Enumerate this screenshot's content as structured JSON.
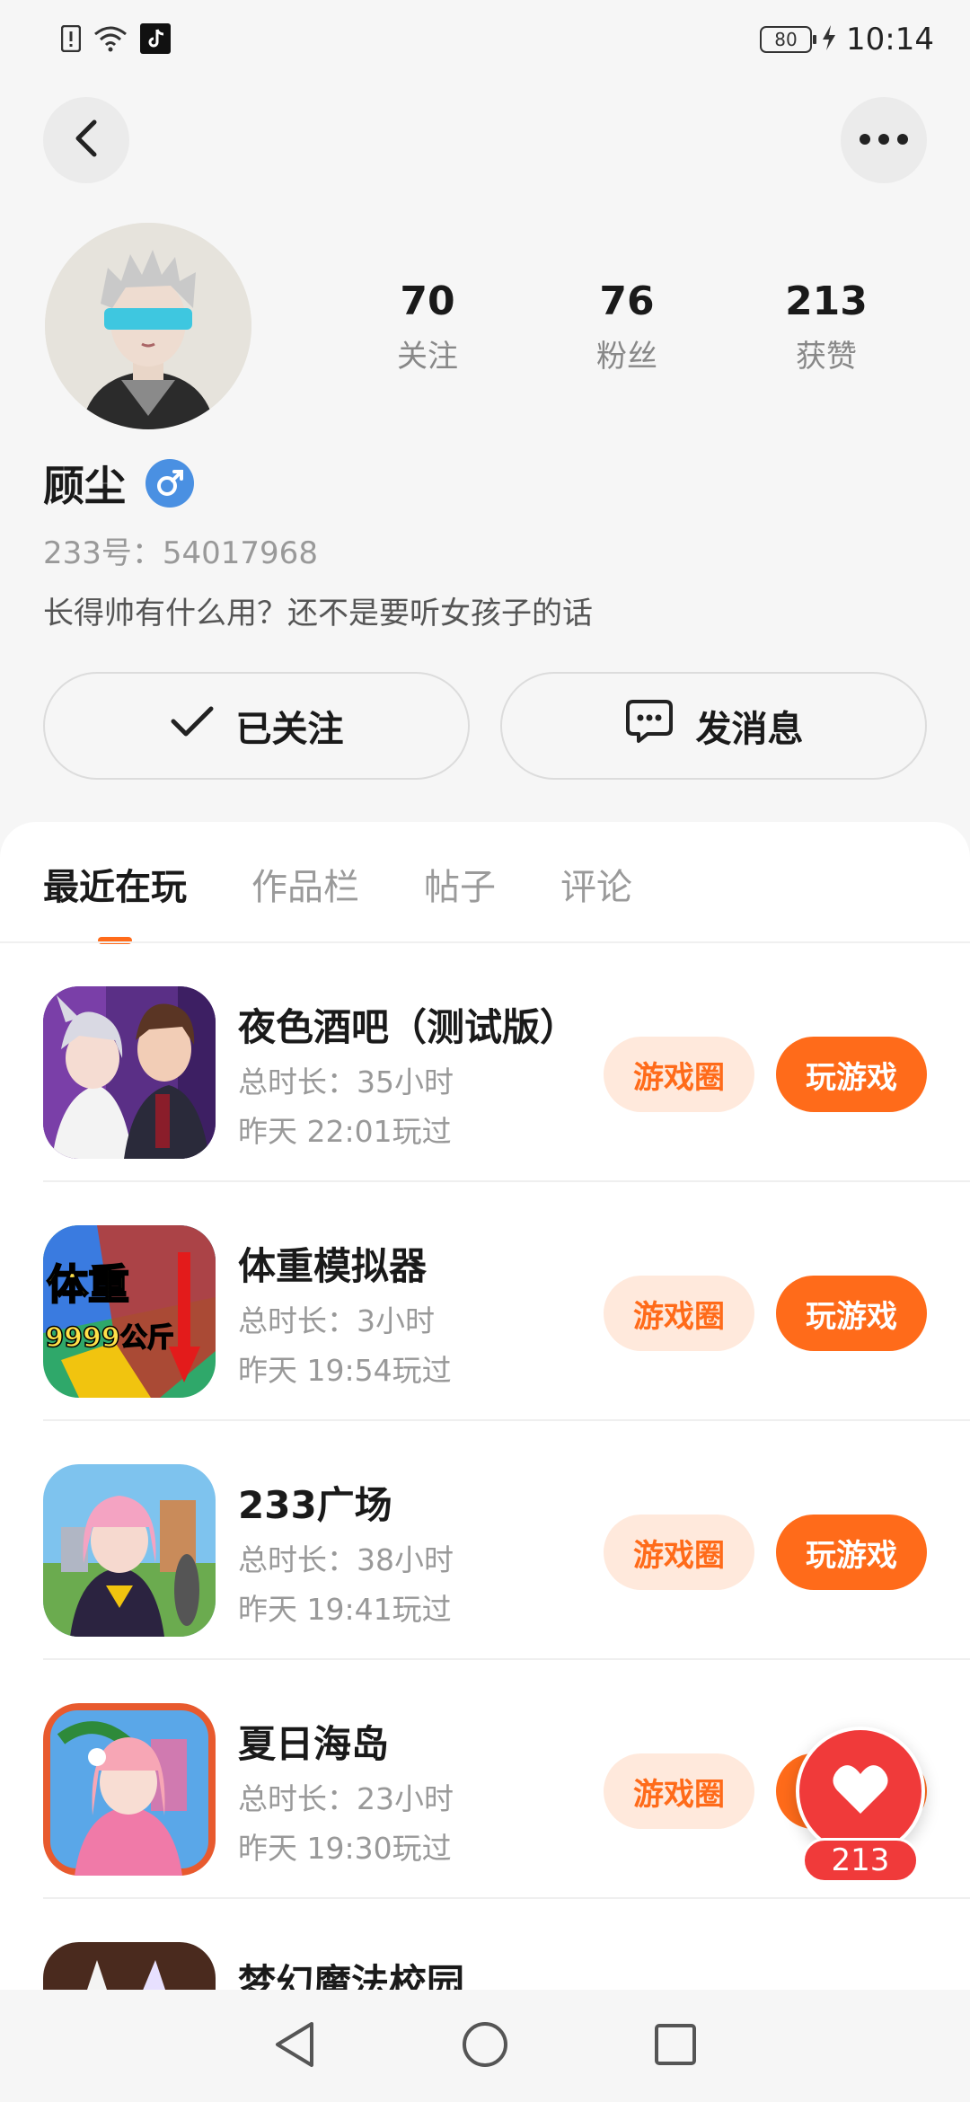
{
  "status_bar": {
    "time": "10:14",
    "battery": "80"
  },
  "profile": {
    "name": "顾尘",
    "uid_label": "233号：54017968",
    "bio": "长得帅有什么用？还不是要听女孩子的话",
    "stats": [
      {
        "value": "70",
        "label": "关注"
      },
      {
        "value": "76",
        "label": "粉丝"
      },
      {
        "value": "213",
        "label": "获赞"
      }
    ]
  },
  "actions": {
    "follow_label": "已关注",
    "message_label": "发消息"
  },
  "tabs": [
    "最近在玩",
    "作品栏",
    "帖子",
    "评论"
  ],
  "games": [
    {
      "name": "夜色酒吧（测试版）",
      "duration": "总时长：35小时",
      "last_played": "昨天 22:01玩过",
      "circle_label": "游戏圈",
      "play_label": "玩游戏"
    },
    {
      "name": "体重模拟器",
      "duration": "总时长：3小时",
      "last_played": "昨天 19:54玩过",
      "circle_label": "游戏圈",
      "play_label": "玩游戏"
    },
    {
      "name": "233广场",
      "duration": "总时长：38小时",
      "last_played": "昨天 19:41玩过",
      "circle_label": "游戏圈",
      "play_label": "玩游戏"
    },
    {
      "name": "夏日海岛",
      "duration": "总时长：23小时",
      "last_played": "昨天 19:30玩过",
      "circle_label": "游戏圈",
      "play_label": "玩游戏"
    },
    {
      "name": "梦幻魔法校园",
      "duration": "",
      "last_played": "",
      "circle_label": "",
      "play_label": ""
    }
  ],
  "icon_text": {
    "weight_line1": "体重",
    "weight_line2": "9999公斤"
  },
  "like": {
    "count": "213"
  },
  "colors": {
    "accent": "#ff6b1a",
    "accent_light": "#ffe9dc",
    "like": "#f03a3a",
    "gender": "#4a90e2"
  }
}
